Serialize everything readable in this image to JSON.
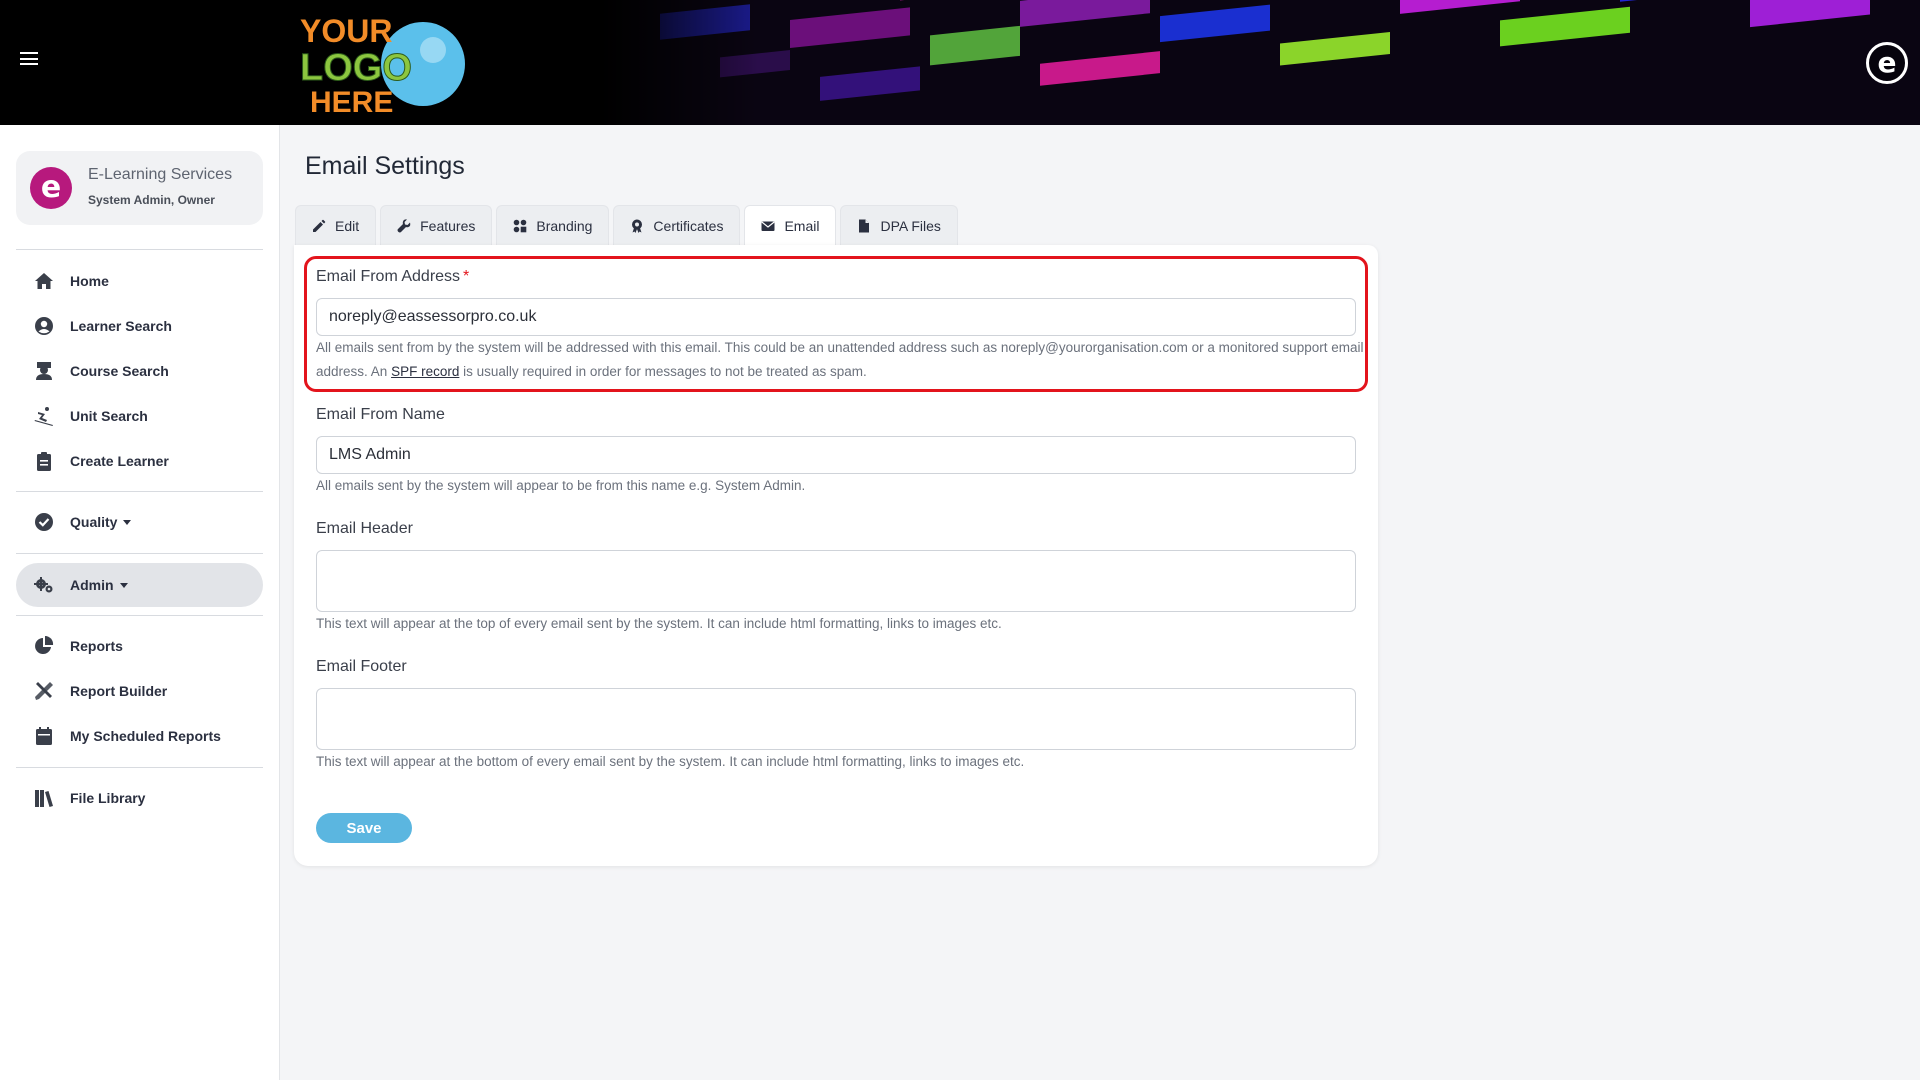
{
  "header": {
    "menu_icon": "hamburger-icon",
    "logo_text": [
      "YOUR",
      "LOGO",
      "HERE"
    ],
    "corner_logo_glyph": "e"
  },
  "sidebar": {
    "profile": {
      "glyph": "e",
      "name": "E-Learning Services",
      "role": "System Admin, Owner"
    },
    "items": [
      {
        "label": "Home",
        "icon": "home-icon"
      },
      {
        "label": "Learner Search",
        "icon": "user-circle-icon"
      },
      {
        "label": "Course Search",
        "icon": "graduate-icon"
      },
      {
        "label": "Unit Search",
        "icon": "skiing-icon"
      },
      {
        "label": "Create Learner",
        "icon": "clipboard-icon"
      },
      {
        "label": "Quality",
        "icon": "check-circle-icon"
      },
      {
        "label": "Admin",
        "icon": "cogs-icon"
      },
      {
        "label": "Reports",
        "icon": "pie-chart-icon"
      },
      {
        "label": "Report Builder",
        "icon": "tools-icon"
      },
      {
        "label": "My Scheduled Reports",
        "icon": "calendar-icon"
      },
      {
        "label": "File Library",
        "icon": "books-icon"
      }
    ]
  },
  "main": {
    "title": "Email Settings",
    "tabs": [
      {
        "label": "Edit",
        "icon": "pencil-icon"
      },
      {
        "label": "Features",
        "icon": "wrench-icon"
      },
      {
        "label": "Branding",
        "icon": "palette-icon"
      },
      {
        "label": "Certificates",
        "icon": "certificate-icon"
      },
      {
        "label": "Email",
        "icon": "envelope-icon"
      },
      {
        "label": "DPA Files",
        "icon": "file-icon"
      }
    ],
    "form": {
      "from_address": {
        "label": "Email From Address",
        "required_mark": "*",
        "value": "noreply@eassessorpro.co.uk",
        "help_part1": "All emails sent from by the system will be addressed with this email. This could be an unattended address such as noreply@yourorganisation.com or a monitored support email address. An ",
        "help_link": "SPF record",
        "help_part2": " is usually required in order for messages to not be treated as spam."
      },
      "from_name": {
        "label": "Email From Name",
        "value": "LMS Admin",
        "help": "All emails sent by the system will appear to be from this name e.g. System Admin."
      },
      "header": {
        "label": "Email Header",
        "value": "",
        "help": "This text will appear at the top of every email sent by the system. It can include html formatting, links to images etc."
      },
      "footer": {
        "label": "Email Footer",
        "value": "",
        "help": "This text will appear at the bottom of every email sent by the system. It can include html formatting, links to images etc."
      },
      "save_label": "Save"
    },
    "highlight_color": "#e3141c",
    "accent_color": "#5bb6e0"
  }
}
